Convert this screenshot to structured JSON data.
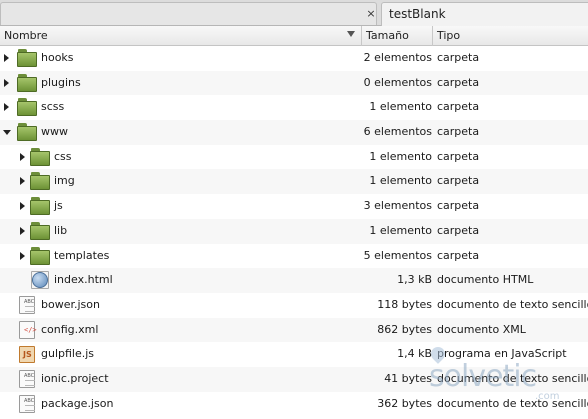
{
  "tabs": {
    "previous": {
      "close_glyph": "×"
    },
    "active": {
      "title": "testBlank"
    }
  },
  "columns": {
    "name": "Nombre",
    "size": "Tamaño",
    "type": "Tipo"
  },
  "rows": [
    {
      "name": "hooks",
      "size": "2 elementos",
      "type": "carpeta",
      "icon": "folder-icon",
      "expander": "closed",
      "level": 0
    },
    {
      "name": "plugins",
      "size": "0 elementos",
      "type": "carpeta",
      "icon": "folder-icon",
      "expander": "closed",
      "level": 0
    },
    {
      "name": "scss",
      "size": "1 elemento",
      "type": "carpeta",
      "icon": "folder-icon",
      "expander": "closed",
      "level": 0
    },
    {
      "name": "www",
      "size": "6 elementos",
      "type": "carpeta",
      "icon": "folder-icon",
      "expander": "open",
      "level": 0
    },
    {
      "name": "css",
      "size": "1 elemento",
      "type": "carpeta",
      "icon": "folder-icon",
      "expander": "closed",
      "level": 1
    },
    {
      "name": "img",
      "size": "1 elemento",
      "type": "carpeta",
      "icon": "folder-icon",
      "expander": "closed",
      "level": 1
    },
    {
      "name": "js",
      "size": "3 elementos",
      "type": "carpeta",
      "icon": "folder-icon",
      "expander": "closed",
      "level": 1
    },
    {
      "name": "lib",
      "size": "1 elemento",
      "type": "carpeta",
      "icon": "folder-icon",
      "expander": "closed",
      "level": 1
    },
    {
      "name": "templates",
      "size": "5 elementos",
      "type": "carpeta",
      "icon": "folder-icon",
      "expander": "closed",
      "level": 1
    },
    {
      "name": "index.html",
      "size": "1,3 kB",
      "type": "documento HTML",
      "icon": "html-file-icon",
      "expander": "none",
      "level": 1
    },
    {
      "name": "bower.json",
      "size": "118 bytes",
      "type": "documento de texto sencillo",
      "icon": "text-file-icon",
      "expander": "none",
      "level": 0
    },
    {
      "name": "config.xml",
      "size": "862 bytes",
      "type": "documento XML",
      "icon": "xml-file-icon",
      "expander": "none",
      "level": 0
    },
    {
      "name": "gulpfile.js",
      "size": "1,4 kB",
      "type": "programa en JavaScript",
      "icon": "js-file-icon",
      "expander": "none",
      "level": 0
    },
    {
      "name": "ionic.project",
      "size": "41 bytes",
      "type": "documento de texto sencillo",
      "icon": "text-file-icon",
      "expander": "none",
      "level": 0
    },
    {
      "name": "package.json",
      "size": "362 bytes",
      "type": "documento de texto sencillo",
      "icon": "text-file-icon",
      "expander": "none",
      "level": 0
    }
  ],
  "watermark": {
    "logo_text": "solvetic",
    "domain_text": ".com"
  },
  "colors": {
    "folder": "#8bb04c",
    "header_bg": "#eeeeee",
    "tab_bg": "#dcdcdc"
  }
}
